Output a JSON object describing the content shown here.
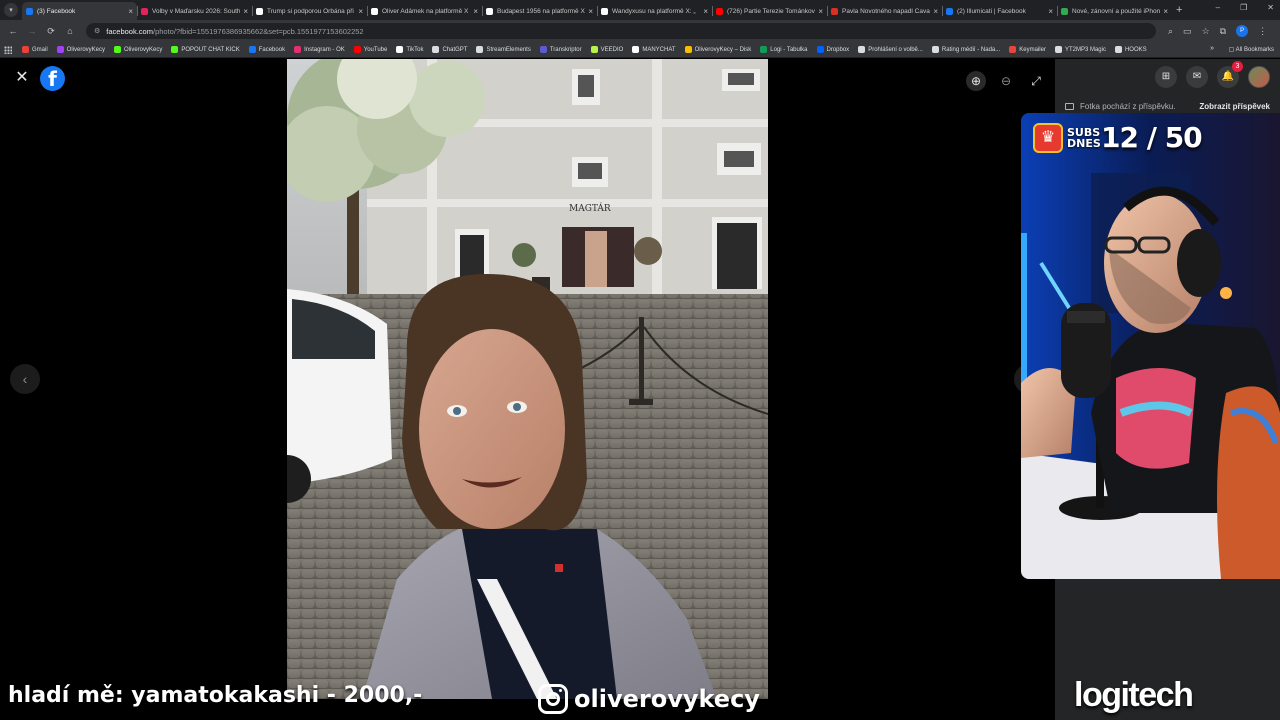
{
  "browser": {
    "tabs": [
      {
        "title": "(3) Facebook",
        "favicon": "facebook-icon",
        "color": "#1877f2",
        "active": true
      },
      {
        "title": "Volby v Maďarsku 2026: South",
        "favicon": "news-icon",
        "color": "#e0245e"
      },
      {
        "title": "Trump si podporou Orbána při",
        "favicon": "k-icon",
        "color": "#ffffff"
      },
      {
        "title": "Oliver Adámek na platformě X",
        "favicon": "x-icon",
        "color": "#ffffff"
      },
      {
        "title": "Budapest 1956 na platformě X",
        "favicon": "x-icon",
        "color": "#ffffff"
      },
      {
        "title": "Wandyxusu na platformě X: „",
        "favicon": "x-icon",
        "color": "#ffffff"
      },
      {
        "title": "(726) Partie Terezie Tománková",
        "favicon": "youtube-icon",
        "color": "#ff0000"
      },
      {
        "title": "Pavla Novotného napadl Cavan",
        "favicon": "news-icon",
        "color": "#d93025"
      },
      {
        "title": "(2) Illumicati | Facebook",
        "favicon": "facebook-icon",
        "color": "#1877f2"
      },
      {
        "title": "Nové, zánovní a použité iPhone",
        "favicon": "shop-icon",
        "color": "#34a853"
      }
    ],
    "url_host": "facebook.com",
    "url_path": "/photo/?fbid=1551976386935662&set=pcb.1551977153602252",
    "profile_initial": "P",
    "bookmarks": [
      {
        "label": "Gmail",
        "color": "#ea4335"
      },
      {
        "label": "OliverovyKecy",
        "color": "#a142f4"
      },
      {
        "label": "OliverovyKecy",
        "color": "#53fc18"
      },
      {
        "label": "POPOUT CHAT KICK",
        "color": "#53fc18"
      },
      {
        "label": "Facebook",
        "color": "#1877f2"
      },
      {
        "label": "Instagram - OK",
        "color": "#e1306c"
      },
      {
        "label": "YouTube",
        "color": "#ff0000"
      },
      {
        "label": "TikTok",
        "color": "#ffffff"
      },
      {
        "label": "ChatGPT",
        "color": "#dadce0"
      },
      {
        "label": "StreamElements",
        "color": "#dadce0"
      },
      {
        "label": "Transkriptor",
        "color": "#5b5bd6"
      },
      {
        "label": "VEEDIO",
        "color": "#b7f34b"
      },
      {
        "label": "MANYCHAT",
        "color": "#ffffff"
      },
      {
        "label": "OliverovyKecy – Disk",
        "color": "#fbbc04"
      },
      {
        "label": "Logi - Tabulka",
        "color": "#0f9d58"
      },
      {
        "label": "Dropbox",
        "color": "#0061ff"
      },
      {
        "label": "Prohlášení o volbě...",
        "color": "#dadce0"
      },
      {
        "label": "Rating médií - Nada...",
        "color": "#dadce0"
      },
      {
        "label": "Keymailer",
        "color": "#e8453c"
      },
      {
        "label": "YT2MP3 Magic",
        "color": "#dadce0"
      },
      {
        "label": "HOOKS",
        "color": "#dadce0"
      }
    ],
    "all_bookmarks_label": "All Bookmarks"
  },
  "viewer": {
    "photo_sign_text": "MAGTÁR",
    "side_note": "Fotka pochází z příspěvku.",
    "side_link": "Zobrazit příspěvek",
    "notification_count": "3"
  },
  "stream": {
    "subs_label": "SUBS DNES",
    "subs_count": "12 / 50",
    "donation_text": "hladí mě: yamatokakashi - 2000,-",
    "instagram_handle": "oliverovykecy",
    "sponsor": "logitech"
  }
}
